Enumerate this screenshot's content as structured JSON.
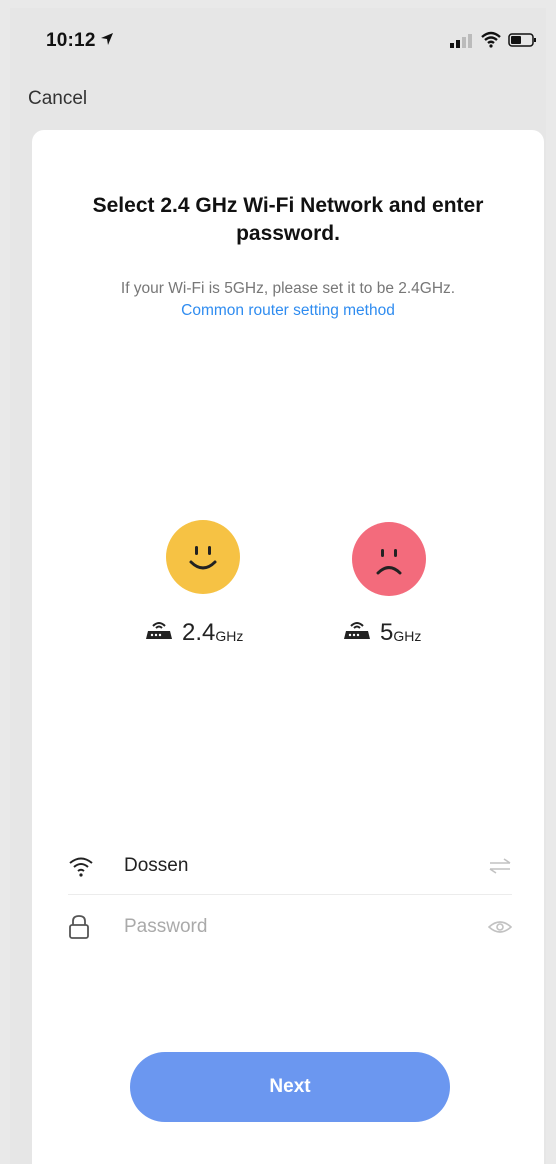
{
  "status_bar": {
    "time": "10:12",
    "location_icon": "location-arrow-icon",
    "signal_icon": "cellular-signal-icon",
    "wifi_icon": "wifi-icon",
    "battery_icon": "battery-icon"
  },
  "nav": {
    "cancel_label": "Cancel"
  },
  "card": {
    "title": "Select 2.4 GHz Wi-Fi Network and enter password.",
    "hint": "If your Wi-Fi is 5GHz, please set it to be 2.4GHz.",
    "link": "Common router setting method"
  },
  "bands": [
    {
      "mood": "happy",
      "value": "2.4",
      "unit": "GHz",
      "color": "#f6c244"
    },
    {
      "mood": "sad",
      "value": "5",
      "unit": "GHz",
      "color": "#f36b7c"
    }
  ],
  "form": {
    "ssid_value": "Dossen",
    "password_placeholder": "Password"
  },
  "actions": {
    "next_label": "Next"
  },
  "colors": {
    "accent": "#2f8cf0",
    "button": "#6b97f0"
  }
}
